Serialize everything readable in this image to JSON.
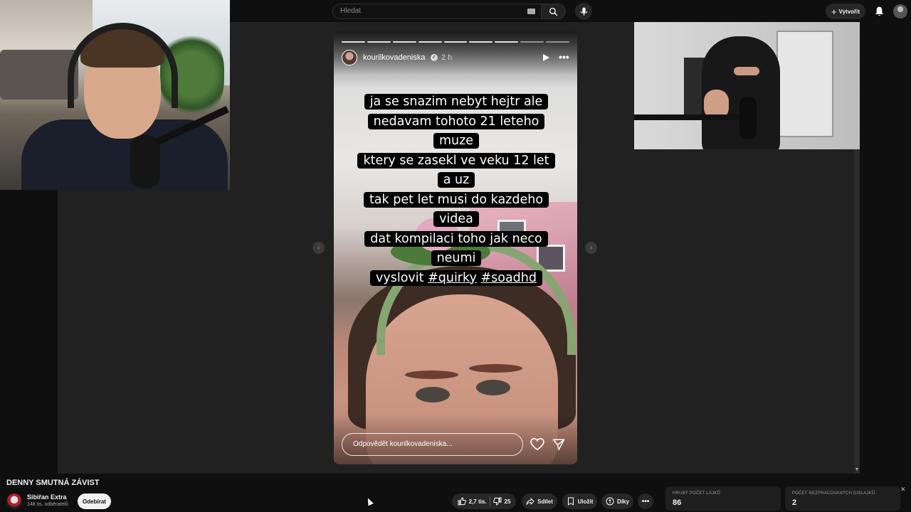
{
  "header": {
    "search_placeholder": "Hledat",
    "create_label": "Vytvořit"
  },
  "story": {
    "username": "kourilkovadeniska",
    "time": "2 h",
    "caption_lines": [
      "ja se snazim nebyt hejtr ale",
      "nedavam tohoto 21 leteho muze",
      "ktery se zasekl ve veku 12 let  a uz",
      "tak pet let musi do kazdeho videa",
      "dat kompilaci toho jak neco neumi",
      "vyslovit"
    ],
    "hashtags": [
      "#quirky",
      "#soadhd"
    ],
    "reply_placeholder": "Odpovědět kourilkovadeniska...",
    "progress_segments": 9,
    "progress_viewed": 7
  },
  "video": {
    "title": "DENNY SMUTNÁ ZÁVIST",
    "channel_name": "Sibiřan Extra",
    "subscribers": "148 tis. odběratelů",
    "subscribe_label": "Odebírat"
  },
  "actions": {
    "likes": "2,7 tis.",
    "dislikes": "25",
    "share": "Sdílet",
    "save": "Uložit",
    "thanks": "Díky"
  },
  "stats": [
    {
      "label": "HRUBÝ POČET LAJKŮ",
      "value": "86"
    },
    {
      "label": "POČET NEZPRACOVANÝCH DISLAJKŮ",
      "value": "2"
    }
  ],
  "colors": {
    "background": "#0f0f0f",
    "stage": "#212121",
    "pill": "#272727",
    "caption_bg": "#000000"
  }
}
